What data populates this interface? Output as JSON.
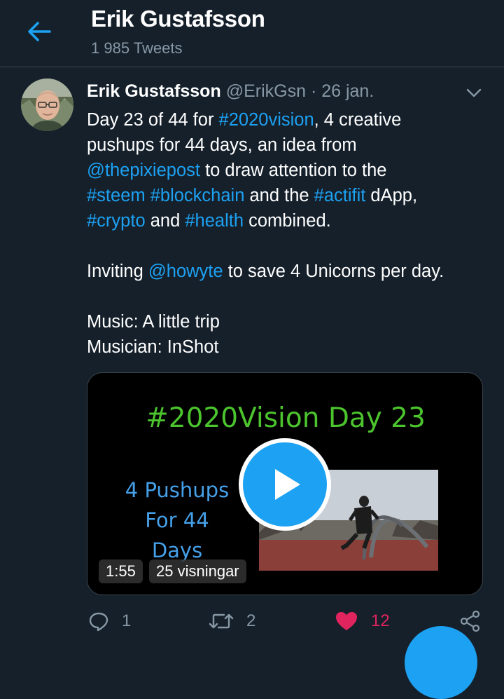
{
  "header": {
    "title": "Erik Gustafsson",
    "subtitle": "1 985 Tweets",
    "back_icon": "arrow-left-icon"
  },
  "tweet": {
    "author_name": "Erik Gustafsson",
    "handle": "@ErikGsn",
    "separator": "·",
    "date": "26 jan.",
    "text": {
      "l1_a": "Day 23 of 44 for ",
      "l1_link": "#2020vision",
      "l1_b": ", 4 creative",
      "l2": "pushups for 44 days, an idea from",
      "l3_link": "@thepixiepost",
      "l3_b": " to draw attention to the",
      "l4_link1": "#steem",
      "l4_sp": " ",
      "l4_link2": "#blockchain",
      "l4_b": " and the ",
      "l4_link3": "#actifit",
      "l4_c": " dApp,",
      "l5_link1": "#crypto",
      "l5_b": " and ",
      "l5_link2": "#health",
      "l5_c": " combined.",
      "l6_a": "Inviting ",
      "l6_link": "@howyte",
      "l6_b": " to save 4 Unicorns per day.",
      "l7": "Music: A little trip",
      "l8": "Musician: InShot"
    },
    "media": {
      "title": "#2020Vision Day 23",
      "sub1": "4 Pushups",
      "sub2": "For 44",
      "sub3": "Days",
      "duration": "1:55",
      "views": "25 visningar"
    },
    "actions": {
      "reply_count": "1",
      "retweet_count": "2",
      "like_count": "12"
    }
  },
  "colors": {
    "background": "#15202b",
    "accent": "#1da1f2",
    "muted": "#8899a6",
    "like": "#e0245e",
    "media_title": "#4cc42e"
  }
}
